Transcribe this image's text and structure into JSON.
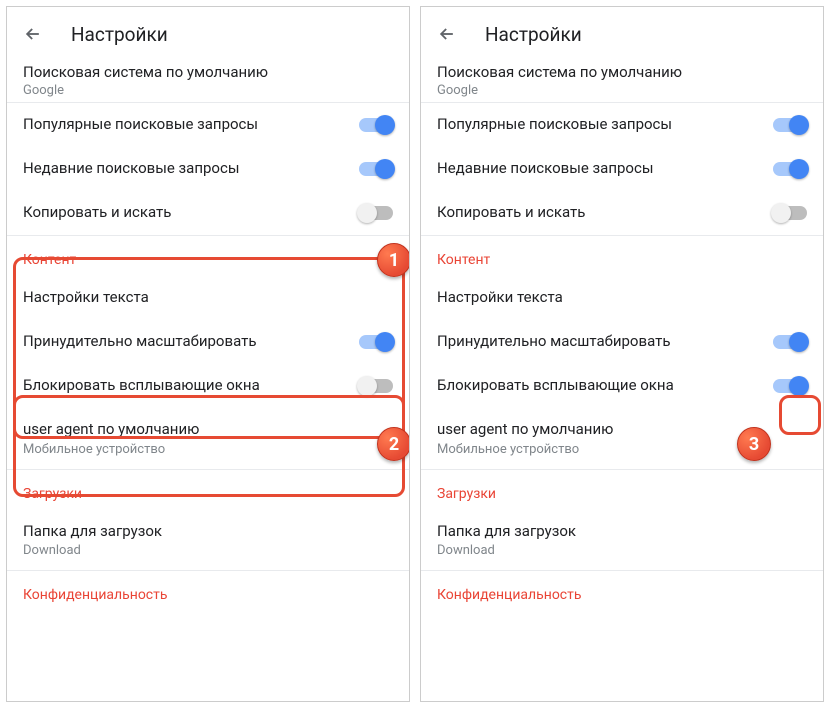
{
  "header": {
    "title": "Настройки"
  },
  "search_engine": {
    "label_trunc": "Поисковая система по умолчанию",
    "value": "Google"
  },
  "rows": {
    "popular": "Популярные поисковые запросы",
    "recent": "Недавние поисковые запросы",
    "copy_search": "Копировать и искать",
    "text_settings": "Настройки текста",
    "force_zoom": "Принудительно масштабировать",
    "block_popups": "Блокировать всплывающие окна",
    "user_agent": "user agent по умолчанию",
    "user_agent_sub": "Мобильное устройство",
    "download_folder": "Папка для загрузок",
    "download_folder_sub": "Download"
  },
  "sections": {
    "content": "Контент",
    "downloads": "Загрузки",
    "privacy": "Конфиденциальность"
  },
  "callouts": {
    "c1": "1",
    "c2": "2",
    "c3": "3"
  }
}
